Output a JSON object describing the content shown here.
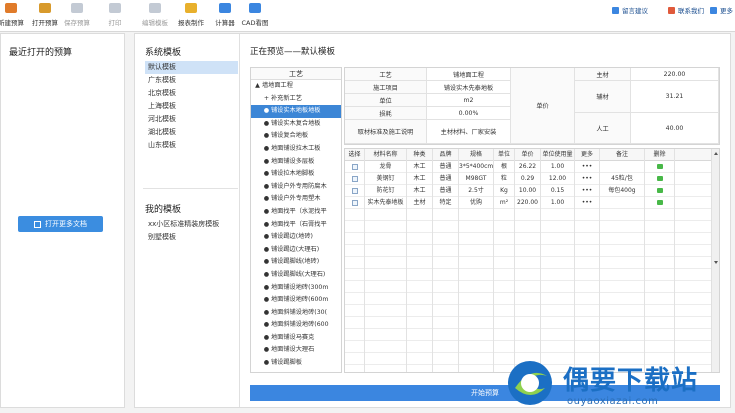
{
  "toolbar": {
    "buttons": [
      {
        "label": "新建预算",
        "icon": "new-budget-icon",
        "color": "#e07b2a",
        "enabled": true
      },
      {
        "label": "打开预算",
        "icon": "open-budget-icon",
        "color": "#d89a2c",
        "enabled": true
      },
      {
        "label": "保存预算",
        "icon": "save-budget-icon",
        "color": "#7a8aa0",
        "enabled": false
      },
      {
        "label": "打印",
        "icon": "print-icon",
        "color": "#7a8aa0",
        "enabled": false
      },
      {
        "label": "编辑模板",
        "icon": "edit-template-icon",
        "color": "#7a8aa0",
        "enabled": false
      },
      {
        "label": "报表制作",
        "icon": "report-icon",
        "color": "#e8b02c",
        "enabled": true
      },
      {
        "label": "计算器",
        "icon": "calculator-icon",
        "color": "#3b86e0",
        "enabled": true
      },
      {
        "label": "CAD看图",
        "icon": "cad-icon",
        "color": "#3b86e0",
        "enabled": true
      }
    ],
    "right_links": [
      {
        "label": "留言建议",
        "icon": "feedback-icon",
        "color": "#3b86e0"
      },
      {
        "label": "联系我们",
        "icon": "contact-icon",
        "color": "#e05a3b"
      },
      {
        "label": "更多",
        "icon": "more-icon",
        "color": "#3b86e0"
      }
    ]
  },
  "left_panel": {
    "title": "最近打开的预算",
    "open_more_label": "打开更多文档"
  },
  "templates": {
    "system_title": "系统模板",
    "system_items": [
      "默认模板",
      "广东模板",
      "北京模板",
      "上海模板",
      "河北模板",
      "湖北模板",
      "山东模板"
    ],
    "selected_system": 0,
    "my_title": "我的模板",
    "my_items": [
      "xx小区标准精装房模板",
      "别墅模板"
    ]
  },
  "preview": {
    "title": "正在预览——默认模板"
  },
  "tree": {
    "header": "工艺",
    "rows": [
      {
        "label": "墙地面工程",
        "toggle": "▲",
        "indent": 0
      },
      {
        "label": "补充新工艺",
        "toggle": "+",
        "indent": 1
      },
      {
        "label": "铺设实木地板地板",
        "toggle": "●",
        "indent": 1
      },
      {
        "label": "铺设实木复合地板",
        "toggle": "●",
        "indent": 1
      },
      {
        "label": "铺设复合地板",
        "toggle": "●",
        "indent": 1
      },
      {
        "label": "地面铺设拉木工板",
        "toggle": "●",
        "indent": 1
      },
      {
        "label": "地面铺设多层板",
        "toggle": "●",
        "indent": 1
      },
      {
        "label": "铺设拉木地脚板",
        "toggle": "●",
        "indent": 1
      },
      {
        "label": "铺设户外专用防腐木",
        "toggle": "●",
        "indent": 1
      },
      {
        "label": "铺设户外专用塑木",
        "toggle": "●",
        "indent": 1
      },
      {
        "label": "地面找平（水泥找平",
        "toggle": "●",
        "indent": 1
      },
      {
        "label": "地面找平（石膏找平",
        "toggle": "●",
        "indent": 1
      },
      {
        "label": "铺设踢边(地砖)",
        "toggle": "●",
        "indent": 1
      },
      {
        "label": "铺设踢边(大理石)",
        "toggle": "●",
        "indent": 1
      },
      {
        "label": "铺设踢脚线(地砖)",
        "toggle": "●",
        "indent": 1
      },
      {
        "label": "铺设踢脚线(大理石)",
        "toggle": "●",
        "indent": 1
      },
      {
        "label": "地面铺设地砖(300m",
        "toggle": "●",
        "indent": 1
      },
      {
        "label": "地面铺设地砖(600m",
        "toggle": "●",
        "indent": 1
      },
      {
        "label": "地面斜铺设地砖(30(",
        "toggle": "●",
        "indent": 1
      },
      {
        "label": "地面斜铺设地砖(600",
        "toggle": "●",
        "indent": 1
      },
      {
        "label": "地面铺设马赛克",
        "toggle": "●",
        "indent": 1
      },
      {
        "label": "地面铺设大理石",
        "toggle": "●",
        "indent": 1
      },
      {
        "label": "铺设踢脚板",
        "toggle": "●",
        "indent": 1
      }
    ],
    "selected": 2
  },
  "info": {
    "craft_label": "工艺",
    "craft_value": "铺地面工程",
    "project_label": "施工项目",
    "project_value": "铺设实木先泰地板",
    "unit_label": "单位",
    "unit_value": "m2",
    "loss_label": "损耗",
    "loss_value": "0.00%",
    "note_label": "取材标准及施工说明",
    "note_value": "主材材料、厂家安装",
    "price_label": "单价",
    "main_label": "主材",
    "main_value": "220.00",
    "aux_label": "辅材",
    "aux_value": "31.21",
    "labor_label": "人工",
    "labor_value": "40.00"
  },
  "grid": {
    "columns": [
      "选择",
      "材料名称",
      "种类",
      "品牌",
      "规格",
      "单位",
      "单价",
      "单位使用量",
      "更多",
      "备注",
      "删除"
    ],
    "rows": [
      {
        "name": "龙骨",
        "type": "木工",
        "brand": "普通",
        "spec": "3*5*400cm",
        "unit": "根",
        "price": "26.22",
        "qty": "1.00",
        "more": "•••",
        "note": ""
      },
      {
        "name": "美钢钉",
        "type": "木工",
        "brand": "普通",
        "spec": "M98GT",
        "unit": "粒",
        "price": "0.29",
        "qty": "12.00",
        "more": "•••",
        "note": "45粒/包"
      },
      {
        "name": "防花钉",
        "type": "木工",
        "brand": "普通",
        "spec": "2.5寸",
        "unit": "Kg",
        "price": "10.00",
        "qty": "0.15",
        "more": "•••",
        "note": "每包400g"
      },
      {
        "name": "实木先泰地板",
        "type": "主材",
        "brand": "特定",
        "spec": "优购",
        "unit": "m²",
        "price": "220.00",
        "qty": "1.00",
        "more": "•••",
        "note": ""
      }
    ]
  },
  "start_button": "开始预算",
  "watermark": {
    "title": "偶要下载站",
    "url": "ouyaoxiazai.com"
  }
}
